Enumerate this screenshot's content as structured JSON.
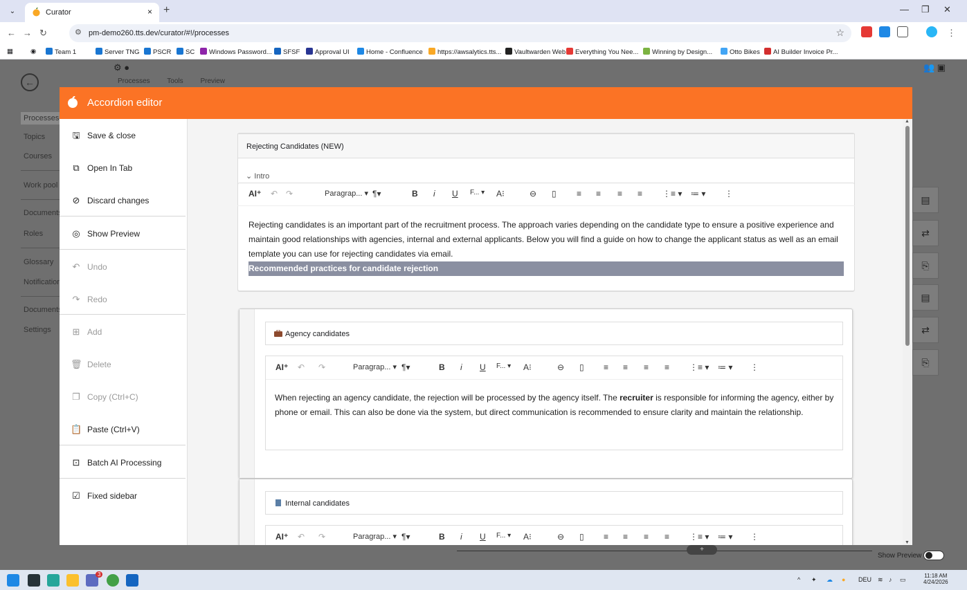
{
  "browser": {
    "tab_title": "Curator",
    "tab_close": "×",
    "new_tab": "+",
    "url": "pm-demo260.tts.dev/curator/#!/processes",
    "bookmarks": [
      "Team 1",
      "Server TNG",
      "PSCR",
      "SC",
      "Windows Password...",
      "SFSF",
      "Approval UI",
      "Home - Confluence",
      "https://awsalytics.tts...",
      "Vaultwarden Web",
      "Everything You Nee...",
      "Winning by Design...",
      "Otto Bikes",
      "AI Builder Invoice Pr..."
    ]
  },
  "app": {
    "tabs": [
      "Processes",
      "Tools",
      "Preview"
    ],
    "nav": [
      "Processes",
      "Topics",
      "Courses",
      "Work pool",
      "Documents",
      "Roles",
      "Glossary",
      "Notifications",
      "Documents",
      "Settings"
    ],
    "plus": "+",
    "show_preview": "Show Preview"
  },
  "modal": {
    "title": "Accordion editor",
    "menu": [
      {
        "label": "Save & close",
        "icon": "save-icon",
        "enabled": true
      },
      {
        "label": "Open In Tab",
        "icon": "open-in-new-icon",
        "enabled": true
      },
      {
        "label": "Discard changes",
        "icon": "block-icon",
        "enabled": true
      },
      {
        "label": "Show Preview",
        "icon": "eye-icon",
        "enabled": true
      },
      {
        "label": "Undo",
        "icon": "undo-icon",
        "enabled": false
      },
      {
        "label": "Redo",
        "icon": "redo-icon",
        "enabled": false
      },
      {
        "label": "Add",
        "icon": "add-box-icon",
        "enabled": false
      },
      {
        "label": "Delete",
        "icon": "delete-icon",
        "enabled": false
      },
      {
        "label": "Copy (Ctrl+C)",
        "icon": "copy-icon",
        "enabled": false
      },
      {
        "label": "Paste (Ctrl+V)",
        "icon": "paste-icon",
        "enabled": true
      },
      {
        "label": "Batch AI Processing",
        "icon": "batch-icon",
        "enabled": true
      },
      {
        "label": "Fixed sidebar",
        "icon": "checkbox-checked-icon",
        "enabled": true
      }
    ],
    "accordion_title": "Rejecting Candidates (NEW)",
    "intro_label": "Intro",
    "toolbar": {
      "paragraph": "Paragrap...",
      "font": "F..."
    },
    "intro_text": "Rejecting candidates is an important part of the recruitment process. The approach varies depending on the candidate type to ensure a positive experience and maintain good relationships with agencies, internal and external applicants. Below you will find a guide on how to change the applicant status as well as an email template you can use for rejecting candidates via email.",
    "intro_highlight": "Recommended practices for candidate rejection",
    "cards": [
      {
        "title": "Agency candidates",
        "text_before": "When rejecting an agency candidate, the rejection will be processed by the agency itself. The ",
        "text_bold": "recruiter",
        "text_after": " is responsible for informing the agency, either by phone or email. This can also be done via the system, but direct communication is recommended to ensure clarity and maintain the relationship."
      },
      {
        "title": "Internal candidates"
      }
    ]
  },
  "taskbar": {
    "language": "DEU",
    "time": "11:18 AM",
    "date": "4/24/2026",
    "teams_badge": "3"
  },
  "colors": {
    "accent": "#fb7325",
    "highlight": "#8a8fa1"
  }
}
